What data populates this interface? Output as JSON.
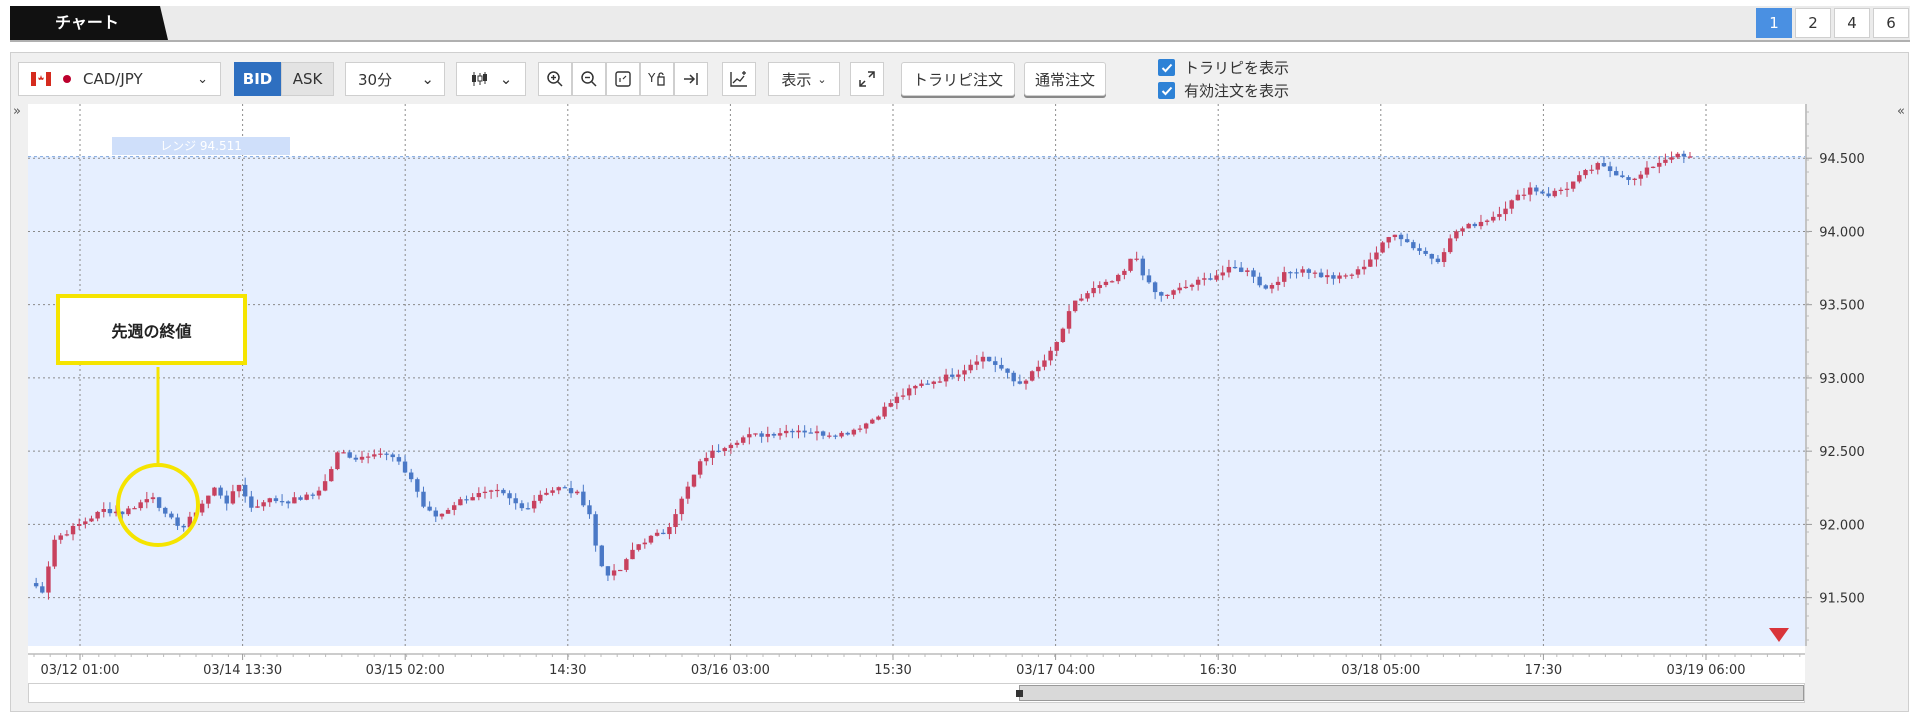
{
  "header": {
    "tab_label": "チャート",
    "layout_buttons": [
      "1",
      "2",
      "4",
      "6"
    ],
    "active_layout": "1"
  },
  "toolbar": {
    "pair": "CAD/JPY",
    "bid_label": "BID",
    "ask_label": "ASK",
    "timeframe": "30分",
    "display_label": "表示",
    "torapi_order_label": "トラリピ注文",
    "normal_order_label": "通常注文",
    "show_torapi_label": "トラリピを表示",
    "show_active_orders_label": "有効注文を表示",
    "show_torapi_checked": true,
    "show_active_orders_checked": true,
    "icons": [
      "zoom-in-icon",
      "zoom-out-icon",
      "fit-screen-icon",
      "y-axis-fit-icon",
      "jump-to-latest-icon",
      "add-indicator-icon",
      "fullscreen-icon"
    ]
  },
  "annotation": {
    "callout_text": "先週の終値"
  },
  "chart_data": {
    "type": "candlestick",
    "symbol": "CAD/JPY",
    "price_side": "BID",
    "timeframe": "30分",
    "y_ticks": [
      94.5,
      94.0,
      93.5,
      93.0,
      92.5,
      92.0,
      91.5
    ],
    "y_tick_labels": [
      "94.500",
      "94.000",
      "93.500",
      "93.000",
      "92.500",
      "92.000",
      "91.500"
    ],
    "ylim": [
      91.17,
      94.87
    ],
    "x_tick_labels": [
      "03/12 01:00",
      "03/14 13:30",
      "03/15 02:00",
      "14:30",
      "03/16 03:00",
      "15:30",
      "03/17 04:00",
      "16:30",
      "03/18 05:00",
      "17:30",
      "03/19 06:00"
    ],
    "range_label": "レンジ 94.511",
    "range_upper": 94.511,
    "colors": {
      "up": "#c8415e",
      "down": "#4a78c6",
      "range_fill": "#e6efff",
      "range_line": "#7fa8e0",
      "callout": "#f5e400",
      "alert_marker": "#d9343a"
    },
    "close_path": [
      [
        0,
        91.6
      ],
      [
        2,
        91.55
      ],
      [
        4,
        91.9
      ],
      [
        8,
        92.0
      ],
      [
        12,
        92.1
      ],
      [
        15,
        92.08
      ],
      [
        18,
        92.15
      ],
      [
        20,
        92.2
      ],
      [
        22,
        92.05
      ],
      [
        25,
        91.98
      ],
      [
        27,
        92.1
      ],
      [
        30,
        92.25
      ],
      [
        32,
        92.15
      ],
      [
        34,
        92.28
      ],
      [
        36,
        92.1
      ],
      [
        38,
        92.17
      ],
      [
        42,
        92.16
      ],
      [
        46,
        92.2
      ],
      [
        48,
        92.3
      ],
      [
        50,
        92.5
      ],
      [
        53,
        92.45
      ],
      [
        56,
        92.5
      ],
      [
        59,
        92.45
      ],
      [
        62,
        92.3
      ],
      [
        64,
        92.1
      ],
      [
        66,
        92.05
      ],
      [
        69,
        92.15
      ],
      [
        72,
        92.2
      ],
      [
        76,
        92.22
      ],
      [
        80,
        92.1
      ],
      [
        83,
        92.22
      ],
      [
        86,
        92.25
      ],
      [
        89,
        92.2
      ],
      [
        91,
        92.05
      ],
      [
        92,
        91.75
      ],
      [
        94,
        91.65
      ],
      [
        96,
        91.7
      ],
      [
        98,
        91.85
      ],
      [
        100,
        91.9
      ],
      [
        103,
        91.95
      ],
      [
        106,
        92.2
      ],
      [
        109,
        92.45
      ],
      [
        113,
        92.55
      ],
      [
        116,
        92.6
      ],
      [
        120,
        92.62
      ],
      [
        124,
        92.65
      ],
      [
        128,
        92.62
      ],
      [
        132,
        92.62
      ],
      [
        136,
        92.7
      ],
      [
        140,
        92.85
      ],
      [
        144,
        92.95
      ],
      [
        148,
        93.0
      ],
      [
        151,
        93.05
      ],
      [
        154,
        93.15
      ],
      [
        157,
        93.08
      ],
      [
        160,
        92.95
      ],
      [
        163,
        93.05
      ],
      [
        166,
        93.2
      ],
      [
        169,
        93.5
      ],
      [
        172,
        93.6
      ],
      [
        175,
        93.65
      ],
      [
        177,
        93.7
      ],
      [
        179,
        93.85
      ],
      [
        181,
        93.65
      ],
      [
        183,
        93.55
      ],
      [
        186,
        93.6
      ],
      [
        189,
        93.65
      ],
      [
        192,
        93.7
      ],
      [
        195,
        93.75
      ],
      [
        198,
        93.72
      ],
      [
        200,
        93.6
      ],
      [
        203,
        93.7
      ],
      [
        206,
        93.75
      ],
      [
        209,
        93.7
      ],
      [
        212,
        93.68
      ],
      [
        215,
        93.72
      ],
      [
        218,
        93.85
      ],
      [
        221,
        94.0
      ],
      [
        224,
        93.9
      ],
      [
        226,
        93.85
      ],
      [
        228,
        93.8
      ],
      [
        231,
        94.0
      ],
      [
        234,
        94.05
      ],
      [
        237,
        94.1
      ],
      [
        240,
        94.2
      ],
      [
        243,
        94.3
      ],
      [
        246,
        94.25
      ],
      [
        249,
        94.3
      ],
      [
        252,
        94.4
      ],
      [
        254,
        94.45
      ],
      [
        257,
        94.4
      ],
      [
        260,
        94.35
      ],
      [
        263,
        94.45
      ],
      [
        266,
        94.52
      ],
      [
        269,
        94.5
      ]
    ]
  }
}
